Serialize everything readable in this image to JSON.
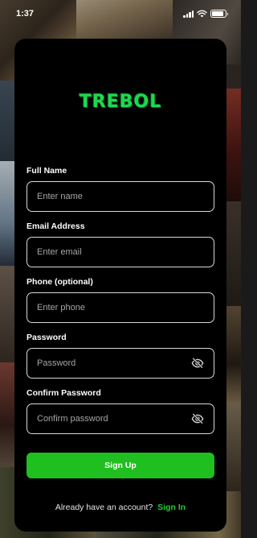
{
  "status_bar": {
    "time": "1:37"
  },
  "app": {
    "logo_text": "TREBOL",
    "brand_color": "#1fd84f"
  },
  "form": {
    "fields": [
      {
        "label": "Full Name",
        "placeholder": "Enter name",
        "value": "",
        "type": "text"
      },
      {
        "label": "Email Address",
        "placeholder": "Enter email",
        "value": "",
        "type": "email"
      },
      {
        "label": "Phone (optional)",
        "placeholder": "Enter phone",
        "value": "",
        "type": "tel"
      },
      {
        "label": "Password",
        "placeholder": "Password",
        "value": "",
        "type": "password",
        "icon": "eye-off-icon"
      },
      {
        "label": "Confirm Password",
        "placeholder": "Confirm password",
        "value": "",
        "type": "password",
        "icon": "eye-off-icon"
      }
    ],
    "submit_label": "Sign Up",
    "submit_color": "#1fbf1f"
  },
  "footer": {
    "prompt": "Already have an account?",
    "link_label": "Sign In",
    "link_color": "#22c83a"
  }
}
